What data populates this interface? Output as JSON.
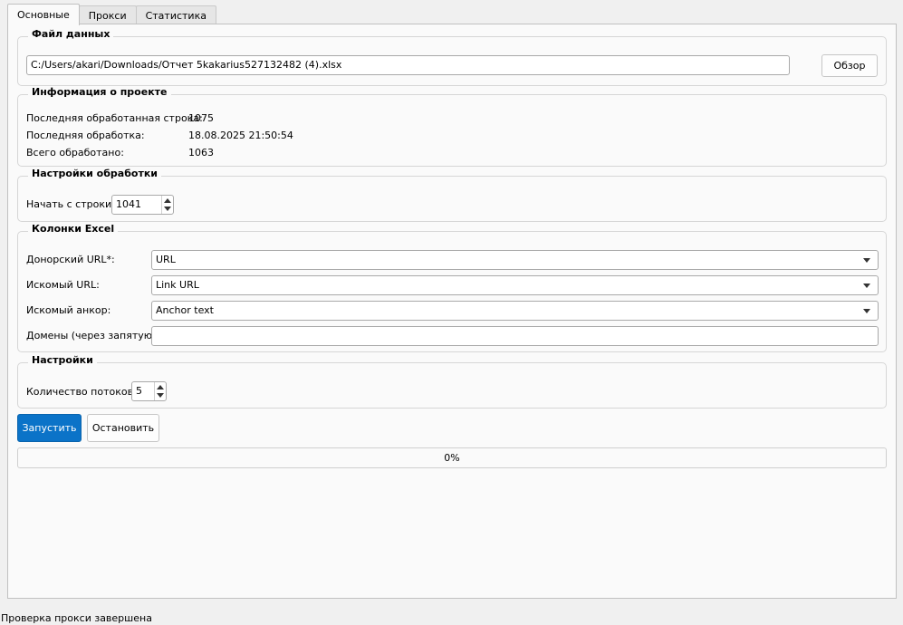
{
  "tabs": [
    {
      "label": "Основные",
      "active": true
    },
    {
      "label": "Прокси",
      "active": false
    },
    {
      "label": "Статистика",
      "active": false
    }
  ],
  "data_file": {
    "title": "Файл данных",
    "path": "C:/Users/akari/Downloads/Отчет 5kakarius527132482 (4).xlsx",
    "browse_label": "Обзор"
  },
  "project_info": {
    "title": "Информация о проекте",
    "rows": [
      {
        "label": "Последняя обработанная строка:",
        "value": "1075"
      },
      {
        "label": "Последняя обработка:",
        "value": "18.08.2025 21:50:54"
      },
      {
        "label": "Всего обработано:",
        "value": "1063"
      }
    ]
  },
  "processing": {
    "title": "Настройки обработки",
    "start_label": "Начать с строки:",
    "start_value": "1041"
  },
  "excel_columns": {
    "title": "Колонки Excel",
    "donor_label": "Донорский URL*:",
    "donor_value": "URL",
    "target_label": "Искомый URL:",
    "target_value": "Link URL",
    "anchor_label": "Искомый анкор:",
    "anchor_value": "Anchor text",
    "domains_label": "Домены (через запятую):",
    "domains_value": ""
  },
  "settings": {
    "title": "Настройки",
    "threads_label": "Количество потоков:",
    "threads_value": "5"
  },
  "actions": {
    "start_label": "Запустить",
    "stop_label": "Остановить"
  },
  "progress": {
    "value": 0,
    "text": "0%"
  },
  "status_bar": {
    "text": "Проверка прокси завершена"
  },
  "colors": {
    "accent": "#0b73c8",
    "panel_bg": "#fafafa",
    "window_bg": "#f0f0f0"
  }
}
